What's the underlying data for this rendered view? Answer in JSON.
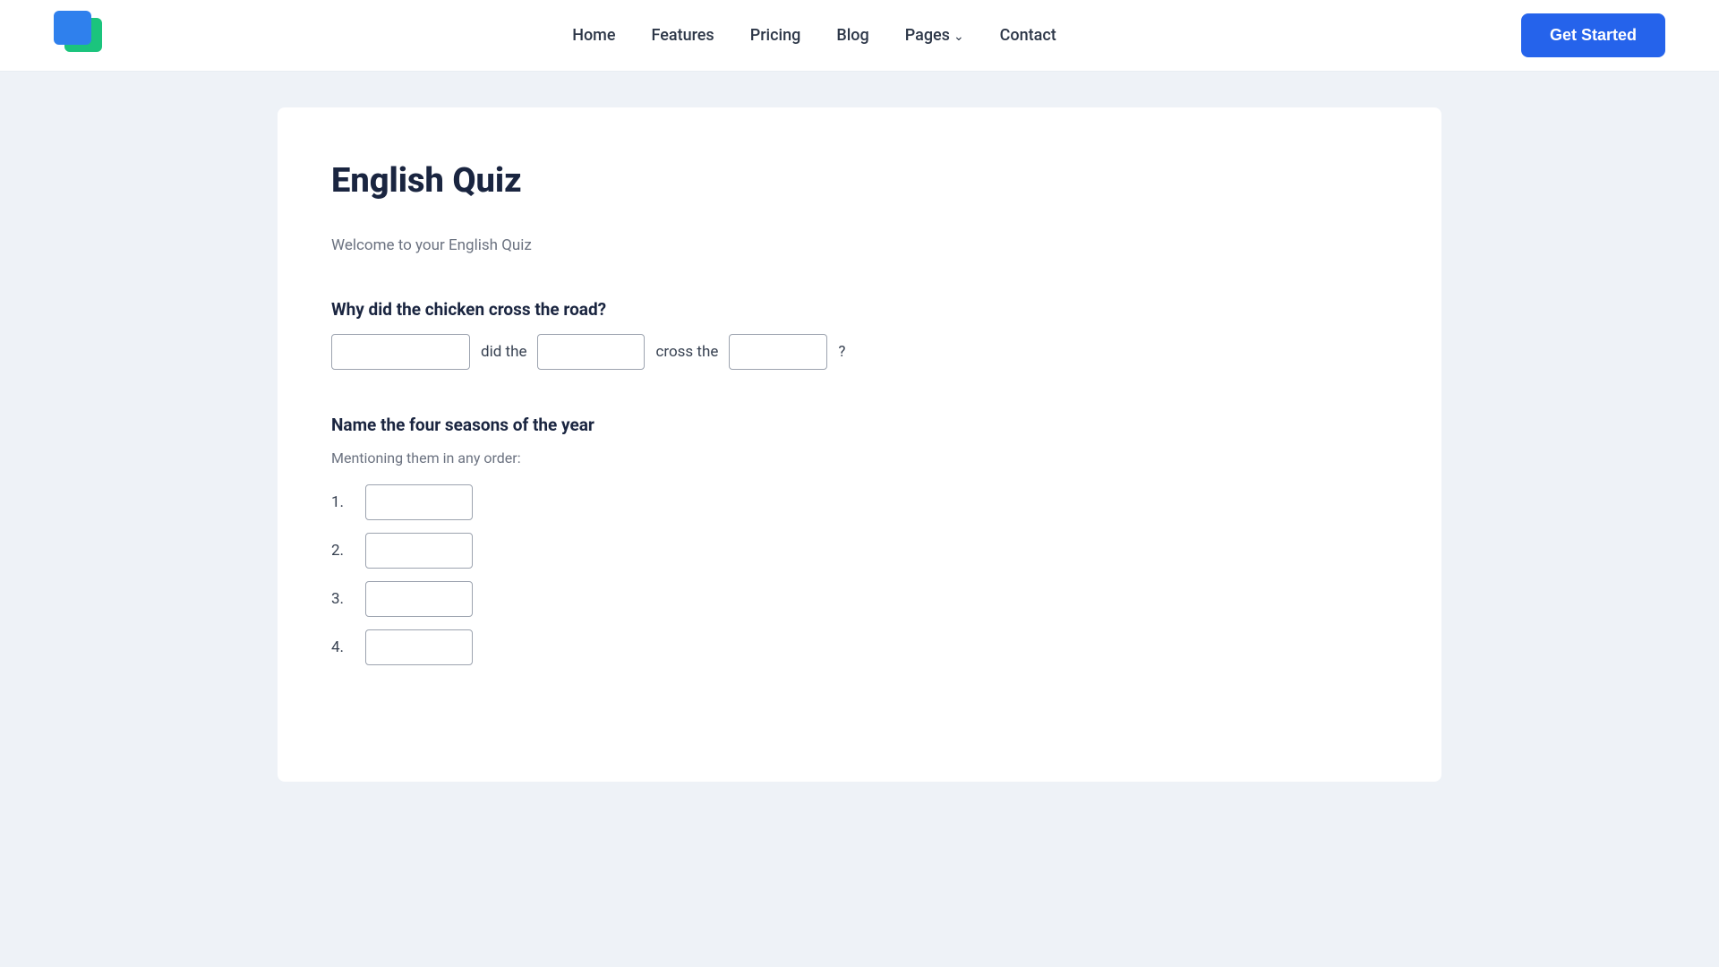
{
  "header": {
    "logo_alt": "App Logo",
    "nav": {
      "home": "Home",
      "features": "Features",
      "pricing": "Pricing",
      "blog": "Blog",
      "pages": "Pages",
      "contact": "Contact"
    },
    "cta_button": "Get Started"
  },
  "page": {
    "title": "English Quiz",
    "welcome": "Welcome to your English Quiz",
    "questions": [
      {
        "id": "q1",
        "label": "Why did the chicken cross the road?",
        "type": "fill_in_blank",
        "parts": [
          {
            "type": "blank",
            "size": "wide",
            "placeholder": ""
          },
          {
            "type": "text",
            "content": "did the"
          },
          {
            "type": "blank",
            "size": "medium",
            "placeholder": ""
          },
          {
            "type": "text",
            "content": "cross the"
          },
          {
            "type": "blank",
            "size": "small",
            "placeholder": ""
          },
          {
            "type": "text",
            "content": "?"
          }
        ]
      },
      {
        "id": "q2",
        "label": "Name the four seasons of the year",
        "type": "list",
        "note": "Mentioning them in any order:",
        "items": [
          {
            "number": "1."
          },
          {
            "number": "2."
          },
          {
            "number": "3."
          },
          {
            "number": "4."
          }
        ]
      }
    ]
  }
}
